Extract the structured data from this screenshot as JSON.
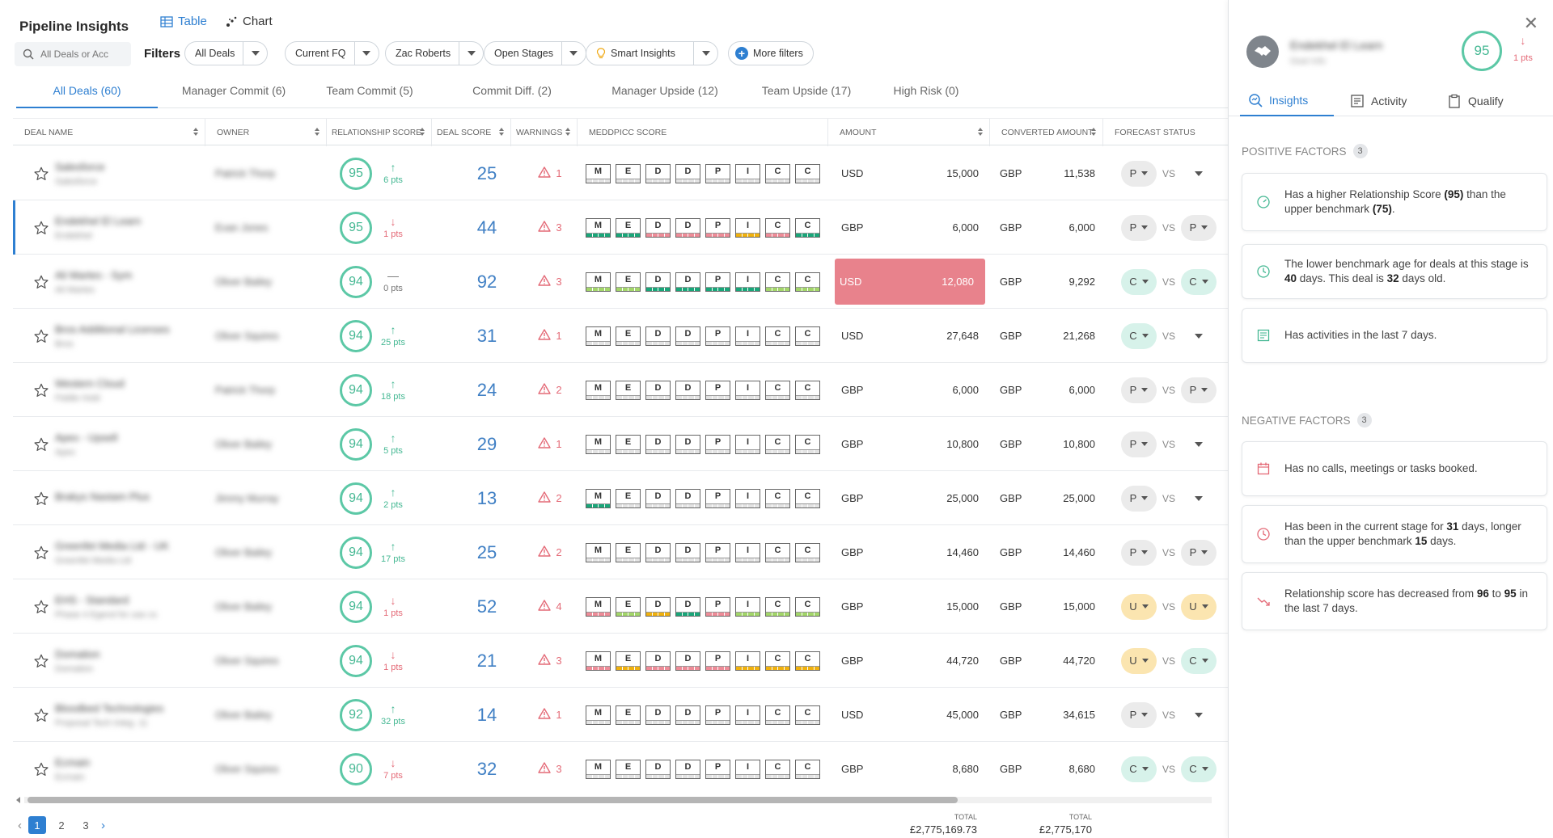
{
  "header": {
    "title": "Pipeline Insights",
    "view_table": "Table",
    "view_chart": "Chart",
    "search_placeholder": "All Deals or Acc",
    "filters_label": "Filters",
    "filters": [
      "All Deals",
      "Current FQ",
      "Zac Roberts",
      "Open Stages",
      "Smart Insights"
    ],
    "more_filters": "More filters"
  },
  "tabs": [
    "All Deals (60)",
    "Manager Commit (6)",
    "Team Commit (5)",
    "Commit Diff. (2)",
    "Manager Upside (12)",
    "Team Upside (17)",
    "High Risk (0)"
  ],
  "columns": [
    "DEAL NAME",
    "OWNER",
    "RELATIONSHIP SCORE",
    "DEAL SCORE",
    "WARNINGS",
    "MEDDPICC SCORE",
    "AMOUNT",
    "CONVERTED AMOUNT",
    "FORECAST STATUS"
  ],
  "meddpicc_letters": [
    "M",
    "E",
    "D",
    "D",
    "P",
    "I",
    "C",
    "C"
  ],
  "rows": [
    {
      "name": "Salesforce",
      "sub": "Salesforce",
      "owner": "Patrick Thorp",
      "rs": "95",
      "trend": "up",
      "pts": "6 pts",
      "ds": "25",
      "warn": "1",
      "medd": [
        "e",
        "e",
        "e",
        "e",
        "e",
        "e",
        "e",
        "e"
      ],
      "cur": "USD",
      "amount": "15,000",
      "ccur": "GBP",
      "camount": "11,538",
      "fs1": "P",
      "fs1c": "g",
      "vs": "VS",
      "fs2": "",
      "fs2c": "",
      "red": false
    },
    {
      "name": "Endekhel El Learn",
      "sub": "Endekhel",
      "owner": "Evan Jones",
      "rs": "95",
      "trend": "down",
      "pts": "1 pts",
      "ds": "44",
      "warn": "3",
      "medd": [
        "g",
        "g",
        "p",
        "p",
        "p",
        "y",
        "p",
        "g"
      ],
      "cur": "GBP",
      "amount": "6,000",
      "ccur": "GBP",
      "camount": "6,000",
      "fs1": "P",
      "fs1c": "g",
      "vs": "VS",
      "fs2": "P",
      "fs2c": "g",
      "red": false,
      "selected": true
    },
    {
      "name": "Ali Martes - Sym",
      "sub": "Ali Martes",
      "owner": "Oliver Bailey",
      "rs": "94",
      "trend": "flat",
      "pts": "0 pts",
      "ds": "92",
      "warn": "3",
      "medd": [
        "lg",
        "lg",
        "g",
        "g",
        "g",
        "g",
        "lg",
        "lg"
      ],
      "cur": "USD",
      "amount": "12,080",
      "ccur": "GBP",
      "camount": "9,292",
      "fs1": "C",
      "fs1c": "c",
      "vs": "VS",
      "fs2": "C",
      "fs2c": "c",
      "red": true
    },
    {
      "name": "Bros Additional Licenses",
      "sub": "Bros",
      "owner": "Oliver Squires",
      "rs": "94",
      "trend": "up",
      "pts": "25 pts",
      "ds": "31",
      "warn": "1",
      "medd": [
        "e",
        "e",
        "e",
        "e",
        "e",
        "e",
        "e",
        "e"
      ],
      "cur": "USD",
      "amount": "27,648",
      "ccur": "GBP",
      "camount": "21,268",
      "fs1": "C",
      "fs1c": "c",
      "vs": "VS",
      "fs2": "",
      "fs2c": "",
      "red": false
    },
    {
      "name": "Western Cloud",
      "sub": "Fiddle Hold",
      "owner": "Patrick Thorp",
      "rs": "94",
      "trend": "up",
      "pts": "18 pts",
      "ds": "24",
      "warn": "2",
      "medd": [
        "e",
        "e",
        "e",
        "e",
        "e",
        "e",
        "e",
        "e"
      ],
      "cur": "GBP",
      "amount": "6,000",
      "ccur": "GBP",
      "camount": "6,000",
      "fs1": "P",
      "fs1c": "g",
      "vs": "VS",
      "fs2": "P",
      "fs2c": "g",
      "red": false
    },
    {
      "name": "Apex - Upsell",
      "sub": "Apex",
      "owner": "Oliver Bailey",
      "rs": "94",
      "trend": "up",
      "pts": "5 pts",
      "ds": "29",
      "warn": "1",
      "medd": [
        "e",
        "e",
        "e",
        "e",
        "e",
        "e",
        "e",
        "e"
      ],
      "cur": "GBP",
      "amount": "10,800",
      "ccur": "GBP",
      "camount": "10,800",
      "fs1": "P",
      "fs1c": "g",
      "vs": "VS",
      "fs2": "",
      "fs2c": "",
      "red": false
    },
    {
      "name": "Brakys Nastam Plus",
      "sub": "",
      "owner": "Jimmy Murray",
      "rs": "94",
      "trend": "up",
      "pts": "2 pts",
      "ds": "13",
      "warn": "2",
      "medd": [
        "g",
        "e",
        "e",
        "e",
        "e",
        "e",
        "e",
        "e"
      ],
      "cur": "GBP",
      "amount": "25,000",
      "ccur": "GBP",
      "camount": "25,000",
      "fs1": "P",
      "fs1c": "g",
      "vs": "VS",
      "fs2": "",
      "fs2c": "",
      "red": false
    },
    {
      "name": "Greenfet Media Ltd - UK",
      "sub": "Greenfet Media Ltd",
      "owner": "Oliver Bailey",
      "rs": "94",
      "trend": "up",
      "pts": "17 pts",
      "ds": "25",
      "warn": "2",
      "medd": [
        "e",
        "e",
        "e",
        "e",
        "e",
        "e",
        "e",
        "e"
      ],
      "cur": "GBP",
      "amount": "14,460",
      "ccur": "GBP",
      "camount": "14,460",
      "fs1": "P",
      "fs1c": "g",
      "vs": "VS",
      "fs2": "P",
      "fs2c": "g",
      "red": false
    },
    {
      "name": "EHS - Standard",
      "sub": "Phase 4 Egend for use cs",
      "owner": "Oliver Bailey",
      "rs": "94",
      "trend": "down",
      "pts": "1 pts",
      "ds": "52",
      "warn": "4",
      "medd": [
        "p",
        "lg",
        "y",
        "g",
        "p",
        "lg",
        "lg",
        "lg"
      ],
      "cur": "GBP",
      "amount": "15,000",
      "ccur": "GBP",
      "camount": "15,000",
      "fs1": "U",
      "fs1c": "u",
      "vs": "VS",
      "fs2": "U",
      "fs2c": "u",
      "red": false
    },
    {
      "name": "Domation",
      "sub": "Domation",
      "owner": "Oliver Squires",
      "rs": "94",
      "trend": "down",
      "pts": "1 pts",
      "ds": "21",
      "warn": "3",
      "medd": [
        "p",
        "y",
        "p",
        "p",
        "p",
        "y",
        "y",
        "y"
      ],
      "cur": "GBP",
      "amount": "44,720",
      "ccur": "GBP",
      "camount": "44,720",
      "fs1": "U",
      "fs1c": "u",
      "vs": "VS",
      "fs2": "C",
      "fs2c": "c",
      "red": false
    },
    {
      "name": "Bloodbed Technologies",
      "sub": "Proposal Tech Integ. 11",
      "owner": "Oliver Bailey",
      "rs": "92",
      "trend": "up",
      "pts": "32 pts",
      "ds": "14",
      "warn": "1",
      "medd": [
        "e",
        "e",
        "e",
        "e",
        "e",
        "e",
        "e",
        "e"
      ],
      "cur": "USD",
      "amount": "45,000",
      "ccur": "GBP",
      "camount": "34,615",
      "fs1": "P",
      "fs1c": "g",
      "vs": "VS",
      "fs2": "",
      "fs2c": "",
      "red": false
    },
    {
      "name": "Ecmain",
      "sub": "Ecmain",
      "owner": "Oliver Squires",
      "rs": "90",
      "trend": "down",
      "pts": "7 pts",
      "ds": "32",
      "warn": "3",
      "medd": [
        "e",
        "e",
        "e",
        "e",
        "e",
        "e",
        "e",
        "e"
      ],
      "cur": "GBP",
      "amount": "8,680",
      "ccur": "GBP",
      "camount": "8,680",
      "fs1": "C",
      "fs1c": "c",
      "vs": "VS",
      "fs2": "C",
      "fs2c": "c",
      "red": false
    }
  ],
  "pagination": {
    "pages": [
      "1",
      "2",
      "3"
    ],
    "current": "1"
  },
  "totals": {
    "label": "TOTAL",
    "amount": "£2,775,169.73",
    "converted": "£2,775,170"
  },
  "panel": {
    "deal_name": "Endekhel El Learn",
    "deal_sub": "Deal Info",
    "score": "95",
    "pts": "1 pts",
    "tabs": [
      "Insights",
      "Activity",
      "Qualify"
    ],
    "positive_label": "POSITIVE FACTORS",
    "positive_count": "3",
    "negative_label": "NEGATIVE FACTORS",
    "negative_count": "3",
    "positive": [
      {
        "icon": "gauge-icon",
        "text": "Has a higher Relationship Score <b>(95)</b> than the upper benchmark <b>(75)</b>."
      },
      {
        "icon": "clock-icon",
        "text": "The lower benchmark age for deals at this stage is <b>40</b> days. This deal is <b>32</b> days old."
      },
      {
        "icon": "activity-list-icon",
        "text": "Has activities in the last 7 days."
      }
    ],
    "negative": [
      {
        "icon": "calendar-icon",
        "text": "Has no calls, meetings or tasks booked."
      },
      {
        "icon": "clock-icon",
        "text": "Has been in the current stage for <b>31</b> days, longer than the upper benchmark <b>15</b> days."
      },
      {
        "icon": "trend-down-icon",
        "text": "Relationship score has decreased from <b>96</b> to <b>95</b> in the last 7 days."
      }
    ]
  },
  "colors": {
    "accent": "#2e7fd1",
    "score_green": "#45b893",
    "warning_red": "#e46a77",
    "amount_highlight": "#e8828c"
  }
}
